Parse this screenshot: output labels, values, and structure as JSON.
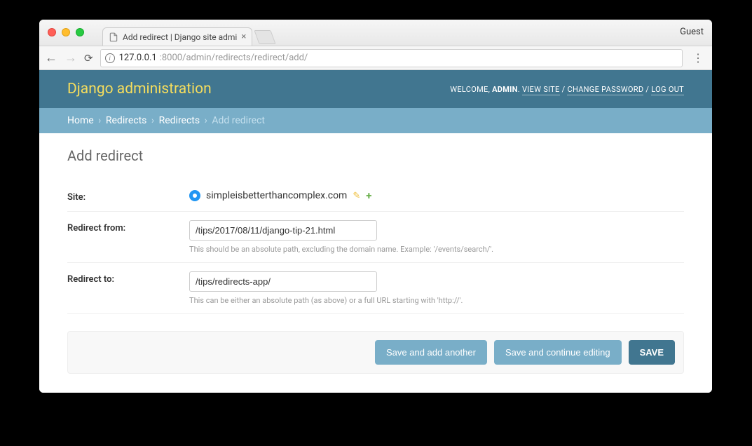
{
  "browser": {
    "guest_label": "Guest",
    "tab_title": "Add redirect | Django site admi",
    "url_host": "127.0.0.1",
    "url_port_path": ":8000/admin/redirects/redirect/add/"
  },
  "header": {
    "brand": "Django administration",
    "welcome_pre": "WELCOME, ",
    "user": "ADMIN",
    "view_site": "VIEW SITE",
    "change_password": "CHANGE PASSWORD",
    "log_out": "LOG OUT"
  },
  "breadcrumbs": {
    "home": "Home",
    "section": "Redirects",
    "model": "Redirects",
    "current": "Add redirect"
  },
  "page_title": "Add redirect",
  "form": {
    "site_label": "Site:",
    "site_value": "simpleisbetterthancomplex.com",
    "redirect_from_label": "Redirect from:",
    "redirect_from_value": "/tips/2017/08/11/django-tip-21.html",
    "redirect_from_help": "This should be an absolute path, excluding the domain name. Example: '/events/search/'.",
    "redirect_to_label": "Redirect to:",
    "redirect_to_value": "/tips/redirects-app/",
    "redirect_to_help": "This can be either an absolute path (as above) or a full URL starting with 'http://'."
  },
  "buttons": {
    "save_add_another": "Save and add another",
    "save_continue": "Save and continue editing",
    "save": "SAVE"
  }
}
